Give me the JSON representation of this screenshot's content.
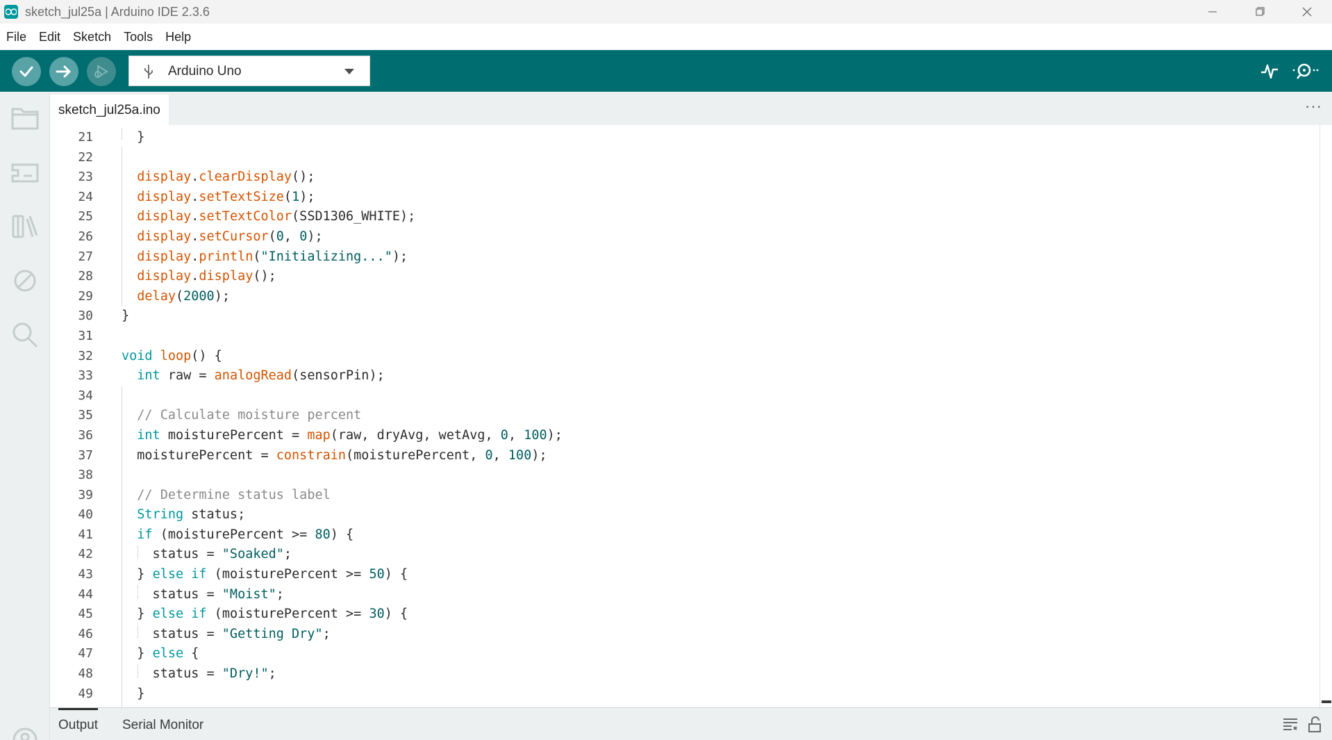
{
  "window": {
    "title": "sketch_jul25a | Arduino IDE 2.3.6",
    "controls": [
      "minimize-icon",
      "restore-icon",
      "close-icon"
    ]
  },
  "menu": [
    "File",
    "Edit",
    "Sketch",
    "Tools",
    "Help"
  ],
  "toolbar": {
    "buttons": [
      "verify-icon",
      "upload-icon",
      "debug-icon"
    ],
    "board": "Arduino Uno",
    "right_icons": [
      "serial-plotter-icon",
      "serial-monitor-icon"
    ],
    "accent": "#006d70"
  },
  "sidebar": [
    "sketchbook-folder-icon",
    "boards-manager-icon",
    "library-manager-icon",
    "debug-disabled-icon",
    "search-icon",
    "profile-icon"
  ],
  "tabs": {
    "active": "sketch_jul25a.ino",
    "more": "···"
  },
  "editor": {
    "line_numbers": [
      "21",
      "22",
      "23",
      "24",
      "25",
      "26",
      "27",
      "28",
      "29",
      "30",
      "31",
      "32",
      "33",
      "34",
      "35",
      "36",
      "37",
      "38",
      "39",
      "40",
      "41",
      "42",
      "43",
      "44",
      "45",
      "46",
      "47",
      "48",
      "49"
    ],
    "lines": [
      "  }",
      "",
      "  display.clearDisplay();",
      "  display.setTextSize(1);",
      "  display.setTextColor(SSD1306_WHITE);",
      "  display.setCursor(0, 0);",
      "  display.println(\"Initializing...\");",
      "  display.display();",
      "  delay(2000);",
      "}",
      "",
      "void loop() {",
      "  int raw = analogRead(sensorPin);",
      "",
      "  // Calculate moisture percent",
      "  int moisturePercent = map(raw, dryAvg, wetAvg, 0, 100);",
      "  moisturePercent = constrain(moisturePercent, 0, 100);",
      "",
      "  // Determine status label",
      "  String status;",
      "  if (moisturePercent >= 80) {",
      "    status = \"Soaked\";",
      "  } else if (moisturePercent >= 50) {",
      "    status = \"Moist\";",
      "  } else if (moisturePercent >= 30) {",
      "    status = \"Getting Dry\";",
      "  } else {",
      "    status = \"Dry!\";",
      "  }"
    ]
  },
  "bottom_panel": {
    "tabs": [
      "Output",
      "Serial Monitor"
    ],
    "icons": [
      "toggle-output-icon",
      "lock-scroll-icon"
    ]
  }
}
